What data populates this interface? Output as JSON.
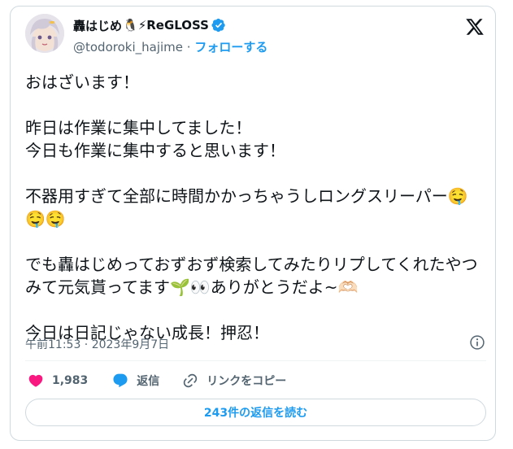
{
  "author": {
    "display_name": "轟はじめ",
    "name_emoji": "🐧⚡",
    "group": "ReGLOSS",
    "handle": "@todoroki_hajime",
    "separator": " · ",
    "follow_label": "フォローする",
    "verified": true
  },
  "tweet": {
    "text": "おはざいます！\n\n昨日は作業に集中してました！\n今日も作業に集中すると思います！\n\n不器用すぎて全部に時間かかっちゃうしロングスリーパー🤤🤤🤤\n\nでも轟はじめっておずおず検索してみたりリプしてくれたやつみて元気貰ってます🌱👀ありがとうだよ~🫶🏻\n\n今日は日記じゃない成長！押忍！",
    "timestamp": "午前11:53 · 2023年9月7日"
  },
  "actions": {
    "like_count": "1,983",
    "reply_label": "返信",
    "copy_link_label": "リンクをコピー"
  },
  "read_replies_label": "243件の返信を読む",
  "colors": {
    "accent": "#1d9bf0",
    "like": "#f91880",
    "text": "#0f1419",
    "secondary": "#536471",
    "border": "#cfd9de"
  },
  "icons": {
    "logo": "x-logo-icon",
    "verified": "verified-badge-icon",
    "info": "info-icon",
    "like": "heart-icon",
    "reply": "speech-bubble-icon",
    "link": "link-icon"
  }
}
